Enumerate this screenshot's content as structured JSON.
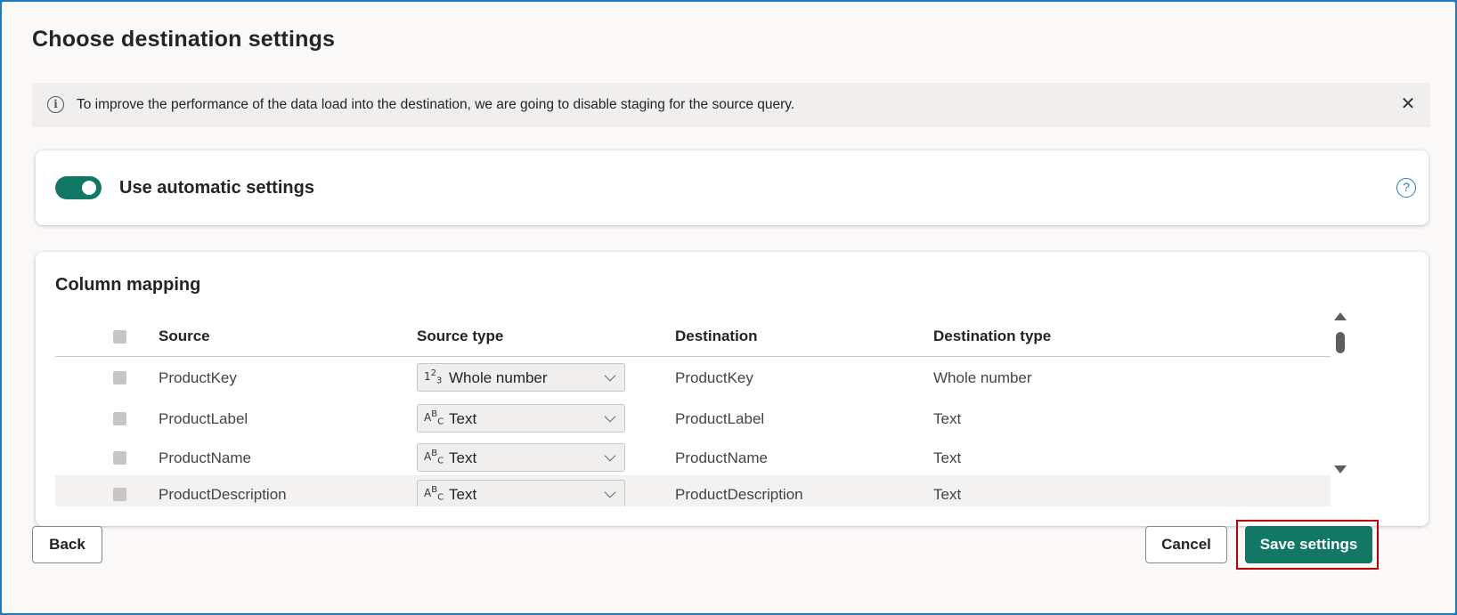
{
  "dialog": {
    "title": "Choose destination settings"
  },
  "info_bar": {
    "icon": "info-icon",
    "message": "To improve the performance of the data load into the destination, we are going to disable staging for the source query.",
    "close_icon": "close-icon",
    "close_glyph": "✕"
  },
  "auto_settings": {
    "toggle_on": true,
    "label": "Use automatic settings",
    "help_glyph": "?"
  },
  "column_mapping": {
    "title": "Column mapping",
    "headers": {
      "source": "Source",
      "source_type": "Source type",
      "destination": "Destination",
      "destination_type": "Destination type"
    },
    "rows": [
      {
        "source": "ProductKey",
        "source_type_icon": "1²₃",
        "source_type": "Whole number",
        "destination": "ProductKey",
        "destination_type": "Whole number"
      },
      {
        "source": "ProductLabel",
        "source_type_icon": "ᴬᴮc",
        "source_type": "Text",
        "destination": "ProductLabel",
        "destination_type": "Text"
      },
      {
        "source": "ProductName",
        "source_type_icon": "ᴬᴮc",
        "source_type": "Text",
        "destination": "ProductName",
        "destination_type": "Text"
      },
      {
        "source": "ProductDescription",
        "source_type_icon": "ᴬᴮc",
        "source_type": "Text",
        "destination": "ProductDescription",
        "destination_type": "Text"
      }
    ]
  },
  "footer": {
    "back_label": "Back",
    "cancel_label": "Cancel",
    "save_label": "Save settings"
  },
  "colors": {
    "accent": "#117865",
    "highlight": "#c00000",
    "link": "#1f7bbd"
  }
}
